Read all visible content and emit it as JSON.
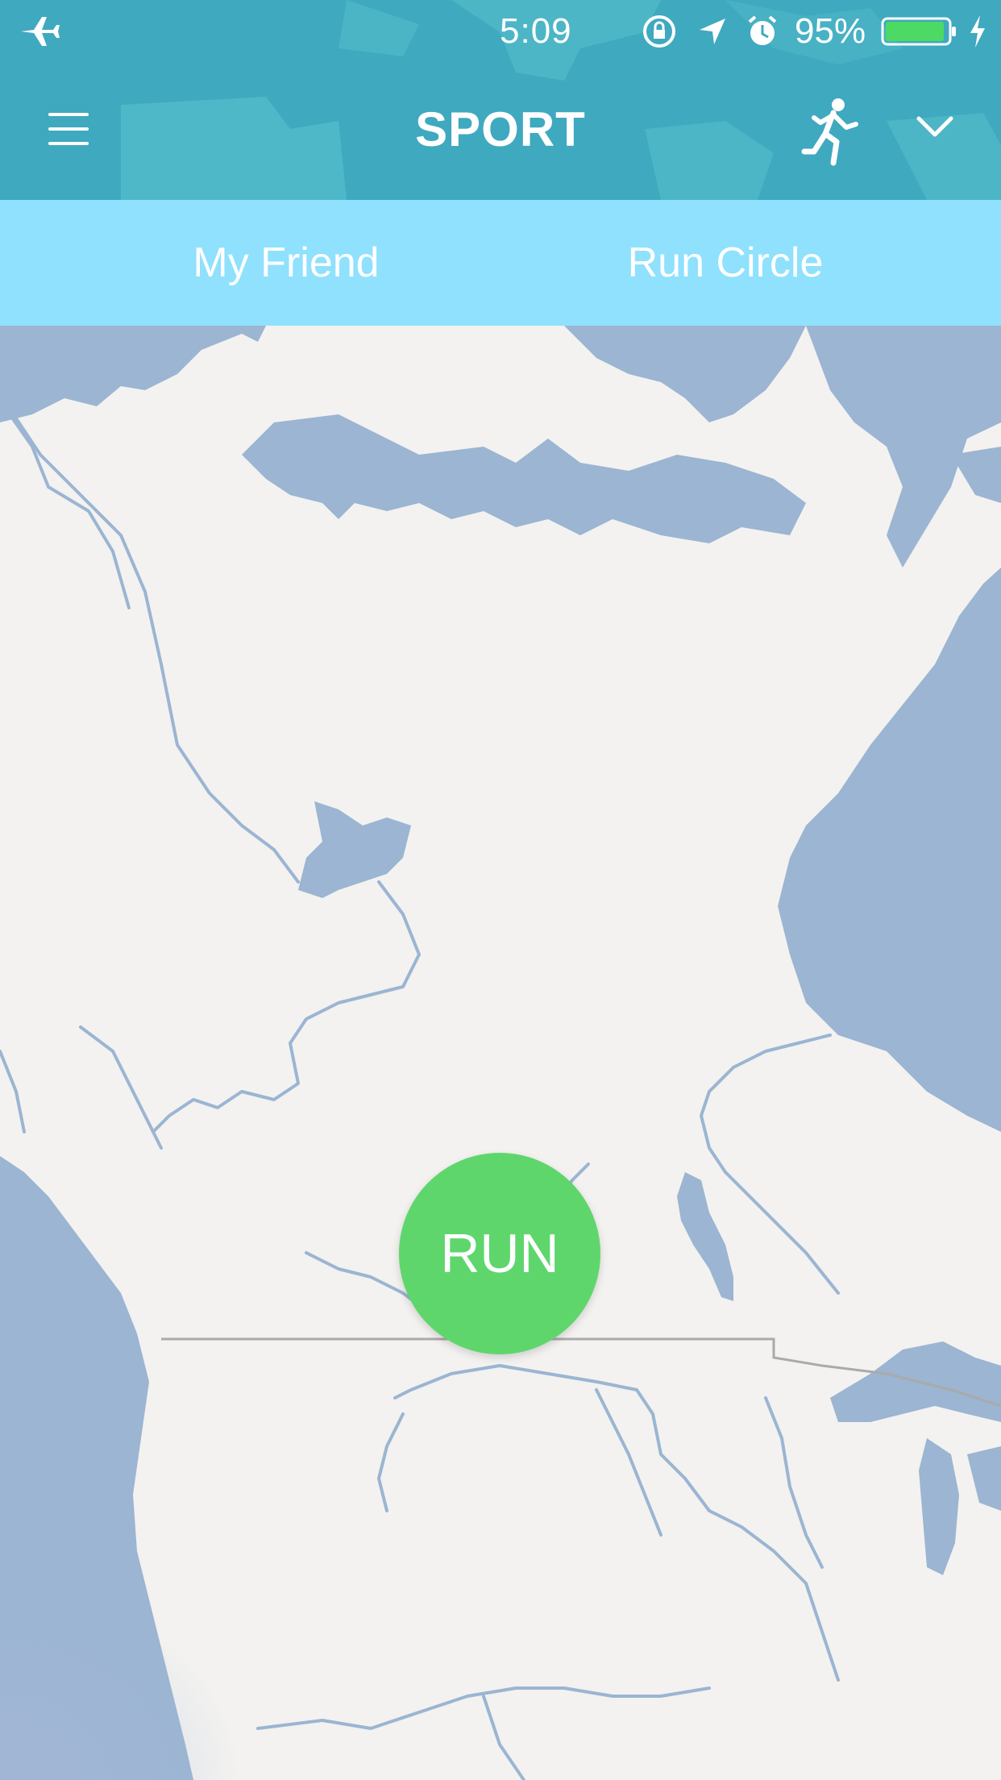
{
  "status_bar": {
    "time": "5:09",
    "battery_percent": "95%",
    "battery_level": 0.95,
    "icons": [
      "airplane-icon",
      "orientation-lock-icon",
      "location-arrow-icon",
      "alarm-icon",
      "battery-icon",
      "charging-bolt-icon"
    ]
  },
  "header": {
    "title": "SPORT",
    "menu_icon": "hamburger-menu-icon",
    "activity_icon": "runner-icon",
    "dropdown_icon": "chevron-down-icon"
  },
  "tabs": [
    {
      "label": "My Friend"
    },
    {
      "label": "Run Circle"
    }
  ],
  "map": {
    "run_button_label": "RUN"
  },
  "colors": {
    "header": "#3fa9bf",
    "tab_bar": "#8fe1fd",
    "map_land": "#f3f2f0",
    "map_water": "#9bb5d2",
    "run_button": "#5fd66c",
    "text_light": "#ffffff"
  }
}
